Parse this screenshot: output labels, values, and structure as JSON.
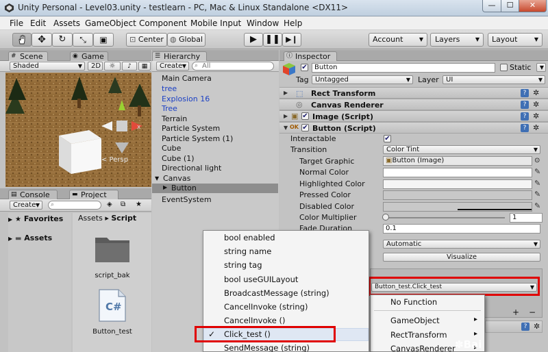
{
  "window": {
    "title": "Unity Personal - Level03.unity - testlearn - PC, Mac & Linux Standalone <DX11>",
    "minimize": "—",
    "maximize": "☐",
    "close": "✕"
  },
  "menubar": [
    "File",
    "Edit",
    "Assets",
    "GameObject",
    "Component",
    "Mobile Input",
    "Window",
    "Help"
  ],
  "toolbar": {
    "tools": [
      "hand-tool",
      "move-tool",
      "rotate-tool",
      "scale-tool",
      "rect-tool"
    ],
    "pivot": "Center",
    "space": "Global",
    "account": "Account",
    "layers": "Layers",
    "layout": "Layout"
  },
  "scene": {
    "tab_scene": "Scene",
    "tab_game": "Game",
    "shading": "Shaded",
    "mode_2d": "2D",
    "persp": "< Persp"
  },
  "bottom_left": {
    "tab_console": "Console",
    "tab_project": "Project",
    "create": "Create",
    "favorites": "Favorites",
    "assets": "Assets",
    "breadcrumb_root": "Assets",
    "breadcrumb_sep": "▸",
    "breadcrumb_folder": "Script",
    "files": [
      {
        "name": "script_bak",
        "icon": "folder-icon"
      },
      {
        "name": "Button_test",
        "icon": "csharp-file-icon",
        "glyph": "C#"
      }
    ]
  },
  "hierarchy": {
    "tab": "Hierarchy",
    "create": "Create",
    "search_placeholder": "All",
    "items": [
      {
        "label": "Main Camera",
        "color": "#111111"
      },
      {
        "label": "tree",
        "color": "#1a3fc4"
      },
      {
        "label": "Explosion 16",
        "color": "#1a3fc4"
      },
      {
        "label": "Tree",
        "color": "#1a3fc4"
      },
      {
        "label": "Terrain",
        "color": "#111111"
      },
      {
        "label": "Particle System",
        "color": "#111111"
      },
      {
        "label": "Particle System (1)",
        "color": "#111111"
      },
      {
        "label": "Cube",
        "color": "#111111"
      },
      {
        "label": "Cube (1)",
        "color": "#111111"
      },
      {
        "label": "Directional light",
        "color": "#111111"
      },
      {
        "label": "Canvas",
        "color": "#111111"
      }
    ],
    "selected": "Button",
    "after": "EventSystem"
  },
  "inspector": {
    "tab": "Inspector",
    "object_name": "Button",
    "static_label": "Static",
    "tag_label": "Tag",
    "tag_value": "Untagged",
    "layer_label": "Layer",
    "layer_value": "UI",
    "components": [
      "Rect Transform",
      "Canvas Renderer",
      "Image (Script)",
      "Button (Script)"
    ],
    "help": "?",
    "gear": "✲",
    "props": {
      "interactable": "Interactable",
      "transition": "Transition",
      "transition_value": "Color Tint",
      "target_graphic": "Target Graphic",
      "target_graphic_value": "Button (Image)",
      "normal_color": "Normal Color",
      "highlighted_color": "Highlighted Color",
      "pressed_color": "Pressed Color",
      "disabled_color": "Disabled Color",
      "color_multiplier": "Color Multiplier",
      "color_multiplier_value": "1",
      "fade_duration": "Fade Duration",
      "fade_duration_value": "0.1",
      "navigation_value": "Automatic",
      "visualize": "Visualize",
      "onclick_function": "Button_test.Click_test",
      "plus": "+",
      "minus": "−"
    },
    "colors": {
      "normal": "#ffffff",
      "highlighted": "#f5f5f5",
      "pressed": "#c8c8c8",
      "disabled": "#c8c8c8"
    }
  },
  "method_menu": {
    "items": [
      "bool enabled",
      "string name",
      "string tag",
      "bool useGUILayout",
      "BroadcastMessage (string)",
      "CancelInvoke (string)",
      "CancelInvoke ()",
      "Click_test ()",
      "SendMessage (string)"
    ],
    "checked_index": 7,
    "check_glyph": "✓"
  },
  "component_menu": {
    "items": [
      {
        "label": "No Function",
        "submenu": false
      },
      {
        "label": "GameObject",
        "submenu": true
      },
      {
        "label": "RectTransform",
        "submenu": true
      },
      {
        "label": "CanvasRenderer",
        "submenu": true
      }
    ],
    "arrow": "▸"
  },
  "watermark": "Bai"
}
